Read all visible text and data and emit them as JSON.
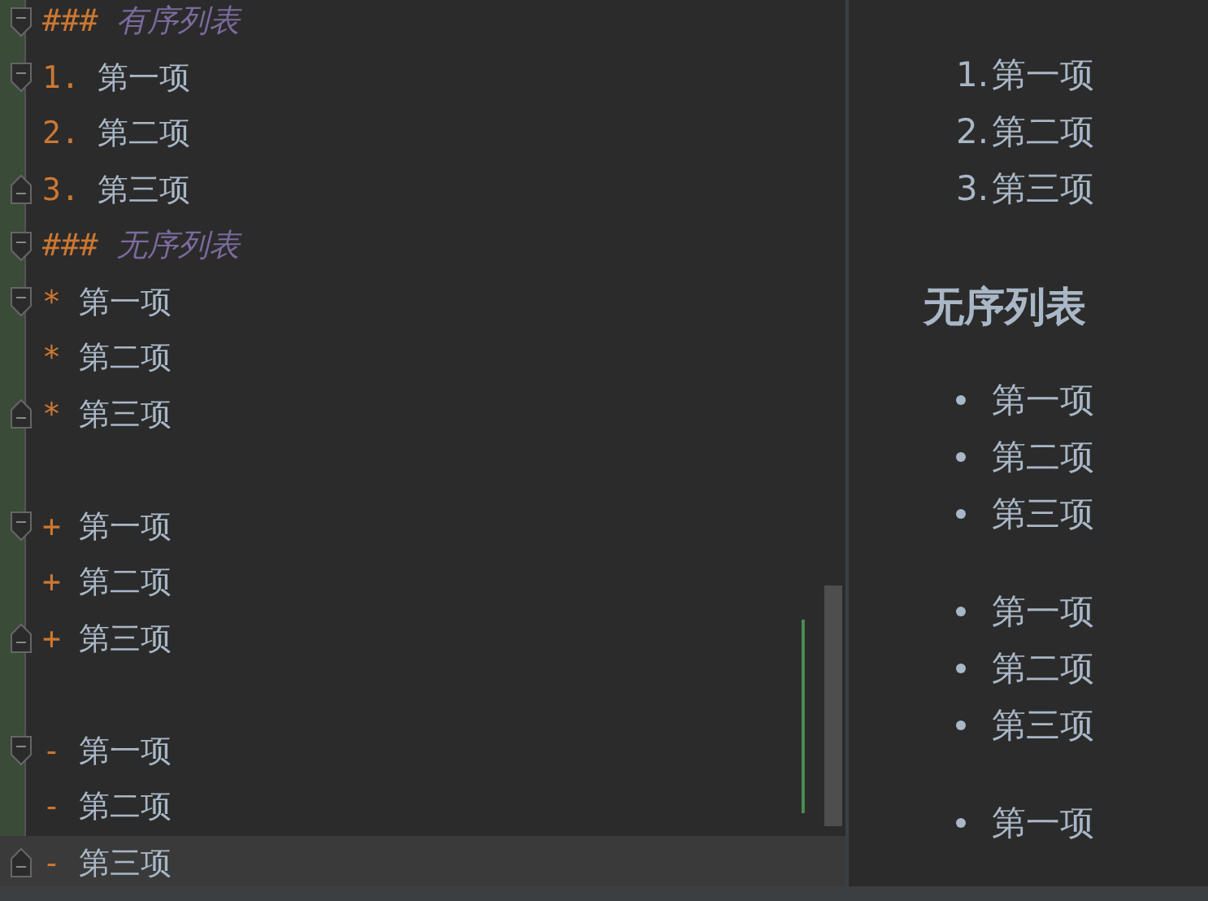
{
  "editor": {
    "lines": [
      {
        "kind": "heading",
        "marker": "###",
        "text": "有序列表",
        "fold_start": true,
        "fold_end": false,
        "selected": false
      },
      {
        "kind": "item",
        "marker": "1.",
        "text": "第一项",
        "fold_start": true,
        "fold_end": false,
        "selected": false
      },
      {
        "kind": "item",
        "marker": "2.",
        "text": "第二项",
        "fold_start": false,
        "fold_end": false,
        "selected": false
      },
      {
        "kind": "item",
        "marker": "3.",
        "text": "第三项",
        "fold_start": false,
        "fold_end": true,
        "selected": false
      },
      {
        "kind": "heading",
        "marker": "###",
        "text": "无序列表",
        "fold_start": true,
        "fold_end": false,
        "selected": false
      },
      {
        "kind": "item",
        "marker": "*",
        "text": "第一项",
        "fold_start": true,
        "fold_end": false,
        "selected": false
      },
      {
        "kind": "item",
        "marker": "*",
        "text": "第二项",
        "fold_start": false,
        "fold_end": false,
        "selected": false
      },
      {
        "kind": "item",
        "marker": "*",
        "text": "第三项",
        "fold_start": false,
        "fold_end": true,
        "selected": false
      },
      {
        "kind": "blank",
        "fold_start": false,
        "fold_end": false,
        "selected": false
      },
      {
        "kind": "item",
        "marker": "+",
        "text": "第一项",
        "fold_start": true,
        "fold_end": false,
        "selected": false
      },
      {
        "kind": "item",
        "marker": "+",
        "text": "第二项",
        "fold_start": false,
        "fold_end": false,
        "selected": false
      },
      {
        "kind": "item",
        "marker": "+",
        "text": "第三项",
        "fold_start": false,
        "fold_end": true,
        "selected": false
      },
      {
        "kind": "blank",
        "fold_start": false,
        "fold_end": false,
        "selected": false
      },
      {
        "kind": "item",
        "marker": "-",
        "text": "第一项",
        "fold_start": true,
        "fold_end": false,
        "selected": false
      },
      {
        "kind": "item",
        "marker": "-",
        "text": "第二项",
        "fold_start": false,
        "fold_end": false,
        "selected": false
      },
      {
        "kind": "item",
        "marker": "-",
        "text": "第三项",
        "fold_start": false,
        "fold_end": true,
        "selected": true
      }
    ]
  },
  "preview": {
    "blocks": [
      {
        "kind": "ordered",
        "items": [
          {
            "number": "1.",
            "text": "第一项"
          },
          {
            "number": "2.",
            "text": "第二项"
          },
          {
            "number": "3.",
            "text": "第三项"
          }
        ]
      },
      {
        "kind": "heading",
        "text": "无序列表"
      },
      {
        "kind": "bullets",
        "items": [
          {
            "text": "第一项"
          },
          {
            "text": "第二项"
          },
          {
            "text": "第三项"
          }
        ]
      },
      {
        "kind": "bullets",
        "items": [
          {
            "text": "第一项"
          },
          {
            "text": "第二项"
          },
          {
            "text": "第三项"
          }
        ]
      },
      {
        "kind": "bullets",
        "items": [
          {
            "text": "第一项"
          }
        ]
      }
    ]
  }
}
